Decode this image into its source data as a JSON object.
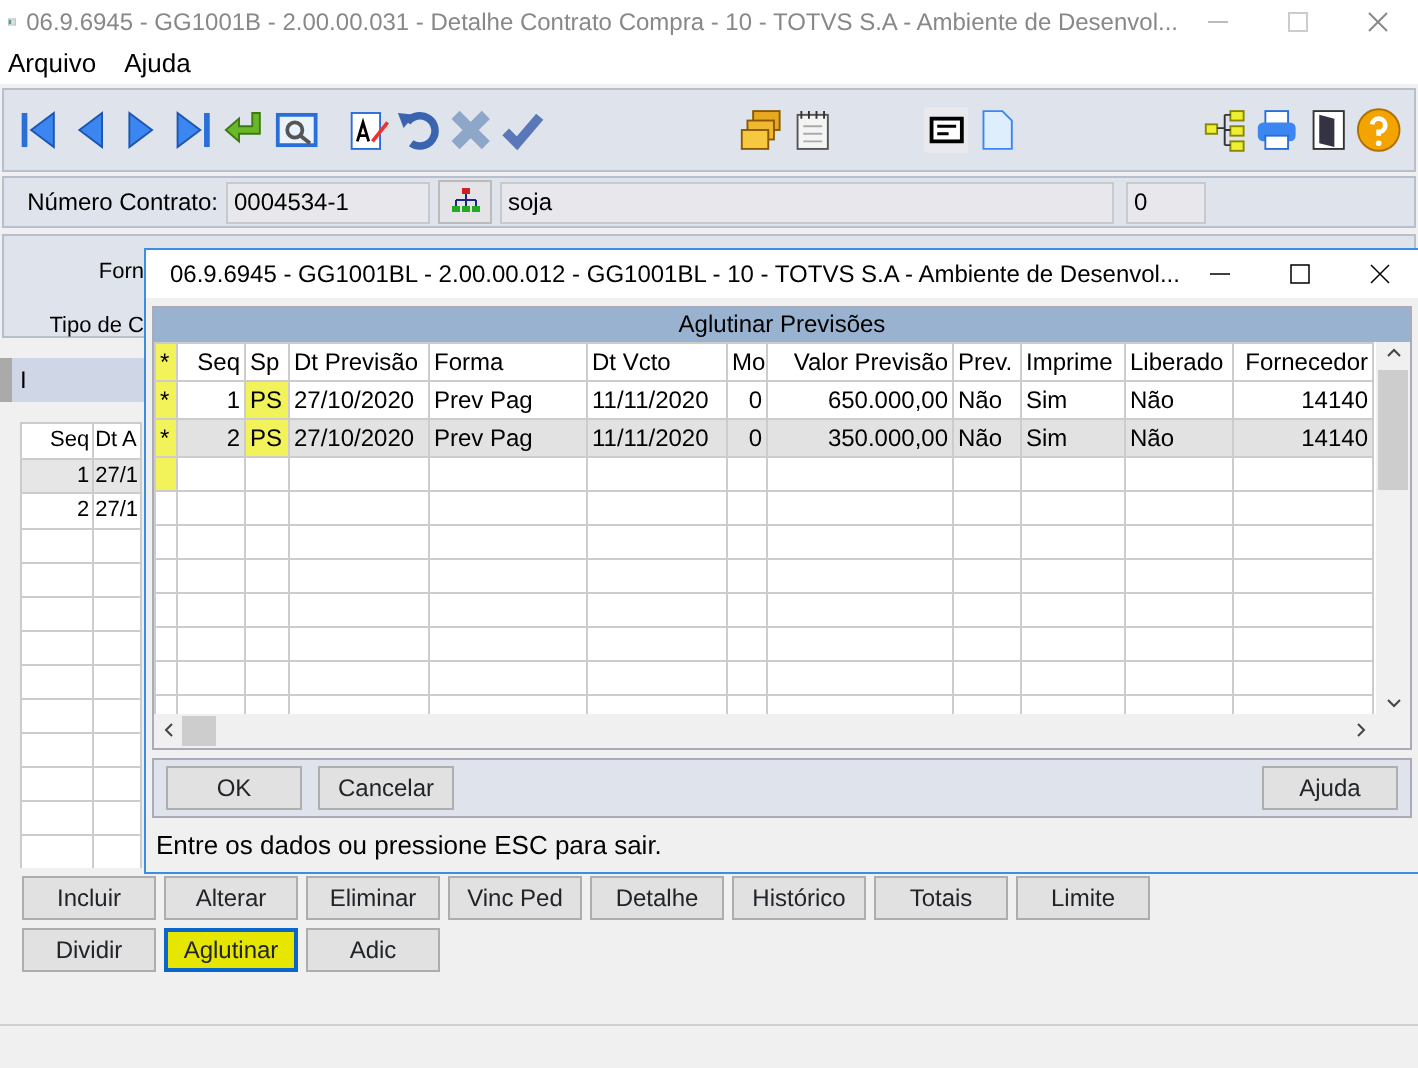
{
  "window": {
    "title": "06.9.6945 - GG1001B - 2.00.00.031 - Detalhe Contrato Compra - 10 - TOTVS S.A - Ambiente de Desenvol..."
  },
  "menu": [
    "Arquivo",
    "Ajuda"
  ],
  "contract": {
    "label": "Número Contrato:",
    "number": "0004534-1",
    "product": "soja",
    "count": "0"
  },
  "form_labels": [
    "Forn",
    "Tipo de C"
  ],
  "tabs": [
    {
      "label": "I",
      "selected": true
    }
  ],
  "grid": {
    "columns": [
      "Seq",
      "Dt A"
    ],
    "rows": [
      {
        "seq": "1",
        "date": "27/1",
        "selected": true
      },
      {
        "seq": "2",
        "date": "27/1",
        "selected": false
      }
    ]
  },
  "buttons": [
    [
      {
        "label": "Incluir",
        "highlighted": false
      },
      {
        "label": "Alterar",
        "highlighted": false
      },
      {
        "label": "Eliminar",
        "highlighted": false
      },
      {
        "label": "Vinc Ped",
        "highlighted": false
      },
      {
        "label": "Detalhe",
        "highlighted": false
      },
      {
        "label": "Histórico",
        "highlighted": false
      },
      {
        "label": "Totais",
        "highlighted": false
      },
      {
        "label": "Limite",
        "highlighted": false
      }
    ],
    [
      {
        "label": "Dividir",
        "highlighted": false
      },
      {
        "label": "Aglutinar",
        "highlighted": true
      },
      {
        "label": "Adic",
        "highlighted": false
      }
    ]
  ],
  "dialog": {
    "title": "06.9.6945 - GG1001BL - 2.00.00.012 - GG1001BL - 10 - TOTVS S.A - Ambiente de Desenvol...",
    "caption": "Aglutinar Previsões",
    "columns": [
      {
        "label": "*",
        "highlighted": true
      },
      {
        "label": "Seq",
        "numeric": true
      },
      {
        "label": "Sp",
        "values_highlighted": true
      },
      {
        "label": "Dt Previsão"
      },
      {
        "label": "Forma"
      },
      {
        "label": "Dt Vcto"
      },
      {
        "label": "Mo",
        "numeric": true
      },
      {
        "label": "Valor Previsão",
        "numeric": true
      },
      {
        "label": "Prev."
      },
      {
        "label": "Imprime"
      },
      {
        "label": "Liberado"
      },
      {
        "label": "Fornecedor",
        "numeric": true
      }
    ],
    "rows": [
      {
        "cells": [
          "*",
          "1",
          "PS",
          "27/10/2020",
          "Prev Pag",
          "11/11/2020",
          "0",
          "650.000,00",
          "Não",
          "Sim",
          "Não",
          "14140"
        ],
        "selected": false
      },
      {
        "cells": [
          "*",
          "2",
          "PS",
          "27/10/2020",
          "Prev Pag",
          "11/11/2020",
          "0",
          "350.000,00",
          "Não",
          "Sim",
          "Não",
          "14140"
        ],
        "selected": true
      }
    ],
    "buttons": [
      "OK",
      "Cancelar"
    ],
    "help_button": "Ajuda",
    "status": "Entre os dados ou pressione ESC para sair."
  }
}
